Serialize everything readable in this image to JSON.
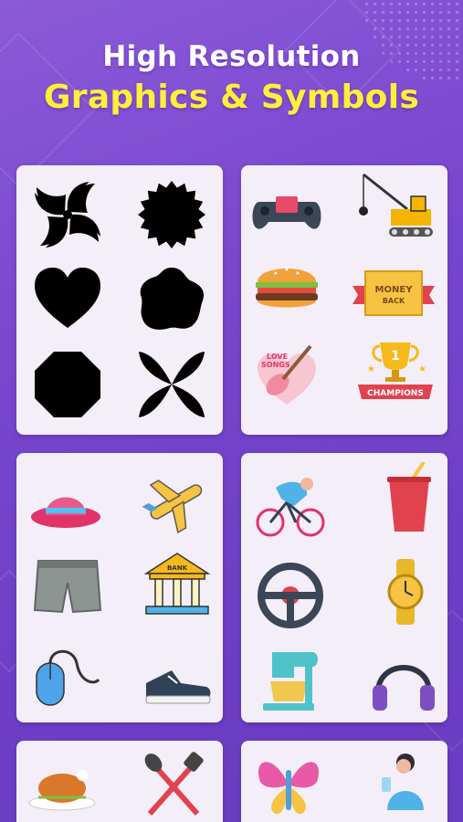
{
  "header": {
    "line1": "High Resolution",
    "line2": "Graphics & Symbols"
  },
  "colors": {
    "background": "#7a47cf",
    "title_white": "#ffffff",
    "title_yellow": "#ffee3a",
    "card": "#f4eef8"
  },
  "cards": [
    {
      "name": "shapes-card",
      "icons": [
        "pinwheel-shape-icon",
        "starburst-shape-icon",
        "heart-shape-icon",
        "blob-flower-shape-icon",
        "octagon-shape-icon",
        "four-petal-shape-icon"
      ]
    },
    {
      "name": "stickers-card-1",
      "icons": [
        "game-controller-icon",
        "crane-truck-icon",
        "burger-icon",
        "money-back-badge-icon",
        "love-songs-guitar-icon",
        "champions-trophy-icon"
      ]
    },
    {
      "name": "stickers-card-2",
      "icons": [
        "sun-hat-icon",
        "airplane-icon",
        "shorts-icon",
        "bank-building-icon",
        "computer-mouse-icon",
        "sneaker-icon"
      ]
    },
    {
      "name": "stickers-card-3",
      "icons": [
        "cyclist-icon",
        "soda-cup-icon",
        "steering-wheel-icon",
        "wrist-watch-icon",
        "stand-mixer-icon",
        "headphones-icon"
      ]
    },
    {
      "name": "stickers-card-4",
      "icons": [
        "roast-turkey-icon",
        "spatula-spoon-icon"
      ]
    },
    {
      "name": "stickers-card-5",
      "icons": [
        "butterfly-icon",
        "person-drinking-icon"
      ]
    }
  ],
  "sticker_text": {
    "money": "MONEY",
    "back": "BACK",
    "love": "LOVE",
    "songs": "SONGS",
    "trophy_number": "1",
    "champions": "CHAMPIONS",
    "bank": "BANK"
  }
}
